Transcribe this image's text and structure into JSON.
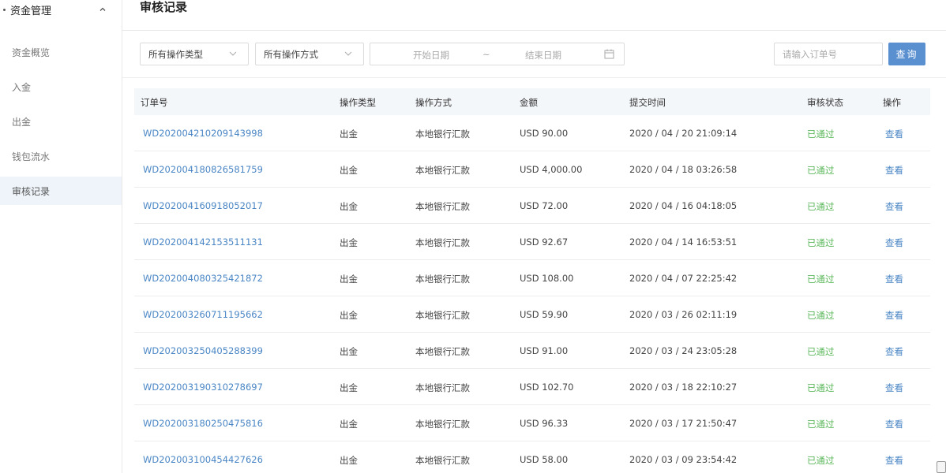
{
  "sidebar": {
    "group_title": "资金管理",
    "items": [
      {
        "label": "资金概览",
        "active": false
      },
      {
        "label": "入金",
        "active": false
      },
      {
        "label": "出金",
        "active": false
      },
      {
        "label": "钱包流水",
        "active": false
      },
      {
        "label": "审核记录",
        "active": true
      }
    ]
  },
  "header": {
    "title": "审核记录"
  },
  "filters": {
    "operation_type": "所有操作类型",
    "operation_method": "所有操作方式",
    "start_date_placeholder": "开始日期",
    "date_separator": "~",
    "end_date_placeholder": "结束日期",
    "order_placeholder": "请输入订单号",
    "query_label": "查询"
  },
  "table": {
    "columns": [
      "订单号",
      "操作类型",
      "操作方式",
      "金额",
      "提交时间",
      "审核状态",
      "操作"
    ],
    "rows": [
      {
        "order": "WD202004210209143998",
        "type": "出金",
        "method": "本地银行汇款",
        "amount": "USD 90.00",
        "time": "2020 / 04 / 20 21:09:14",
        "status": "已通过",
        "action": "查看"
      },
      {
        "order": "WD202004180826581759",
        "type": "出金",
        "method": "本地银行汇款",
        "amount": "USD 4,000.00",
        "time": "2020 / 04 / 18 03:26:58",
        "status": "已通过",
        "action": "查看"
      },
      {
        "order": "WD202004160918052017",
        "type": "出金",
        "method": "本地银行汇款",
        "amount": "USD 72.00",
        "time": "2020 / 04 / 16 04:18:05",
        "status": "已通过",
        "action": "查看"
      },
      {
        "order": "WD202004142153511131",
        "type": "出金",
        "method": "本地银行汇款",
        "amount": "USD 92.67",
        "time": "2020 / 04 / 14 16:53:51",
        "status": "已通过",
        "action": "查看"
      },
      {
        "order": "WD202004080325421872",
        "type": "出金",
        "method": "本地银行汇款",
        "amount": "USD 108.00",
        "time": "2020 / 04 / 07 22:25:42",
        "status": "已通过",
        "action": "查看"
      },
      {
        "order": "WD202003260711195662",
        "type": "出金",
        "method": "本地银行汇款",
        "amount": "USD 59.90",
        "time": "2020 / 03 / 26 02:11:19",
        "status": "已通过",
        "action": "查看"
      },
      {
        "order": "WD202003250405288399",
        "type": "出金",
        "method": "本地银行汇款",
        "amount": "USD 91.00",
        "time": "2020 / 03 / 24 23:05:28",
        "status": "已通过",
        "action": "查看"
      },
      {
        "order": "WD202003190310278697",
        "type": "出金",
        "method": "本地银行汇款",
        "amount": "USD 102.70",
        "time": "2020 / 03 / 18 22:10:27",
        "status": "已通过",
        "action": "查看"
      },
      {
        "order": "WD202003180250475816",
        "type": "出金",
        "method": "本地银行汇款",
        "amount": "USD 96.33",
        "time": "2020 / 03 / 17 21:50:47",
        "status": "已通过",
        "action": "查看"
      },
      {
        "order": "WD202003100454427626",
        "type": "出金",
        "method": "本地银行汇款",
        "amount": "USD 58.00",
        "time": "2020 / 03 / 09 23:54:42",
        "status": "已通过",
        "action": "查看"
      }
    ]
  },
  "colors": {
    "link": "#4a86c5",
    "status_ok": "#5cb85c",
    "primary_button": "#5a8fd0",
    "active_sidebar": "#eef4fa"
  }
}
